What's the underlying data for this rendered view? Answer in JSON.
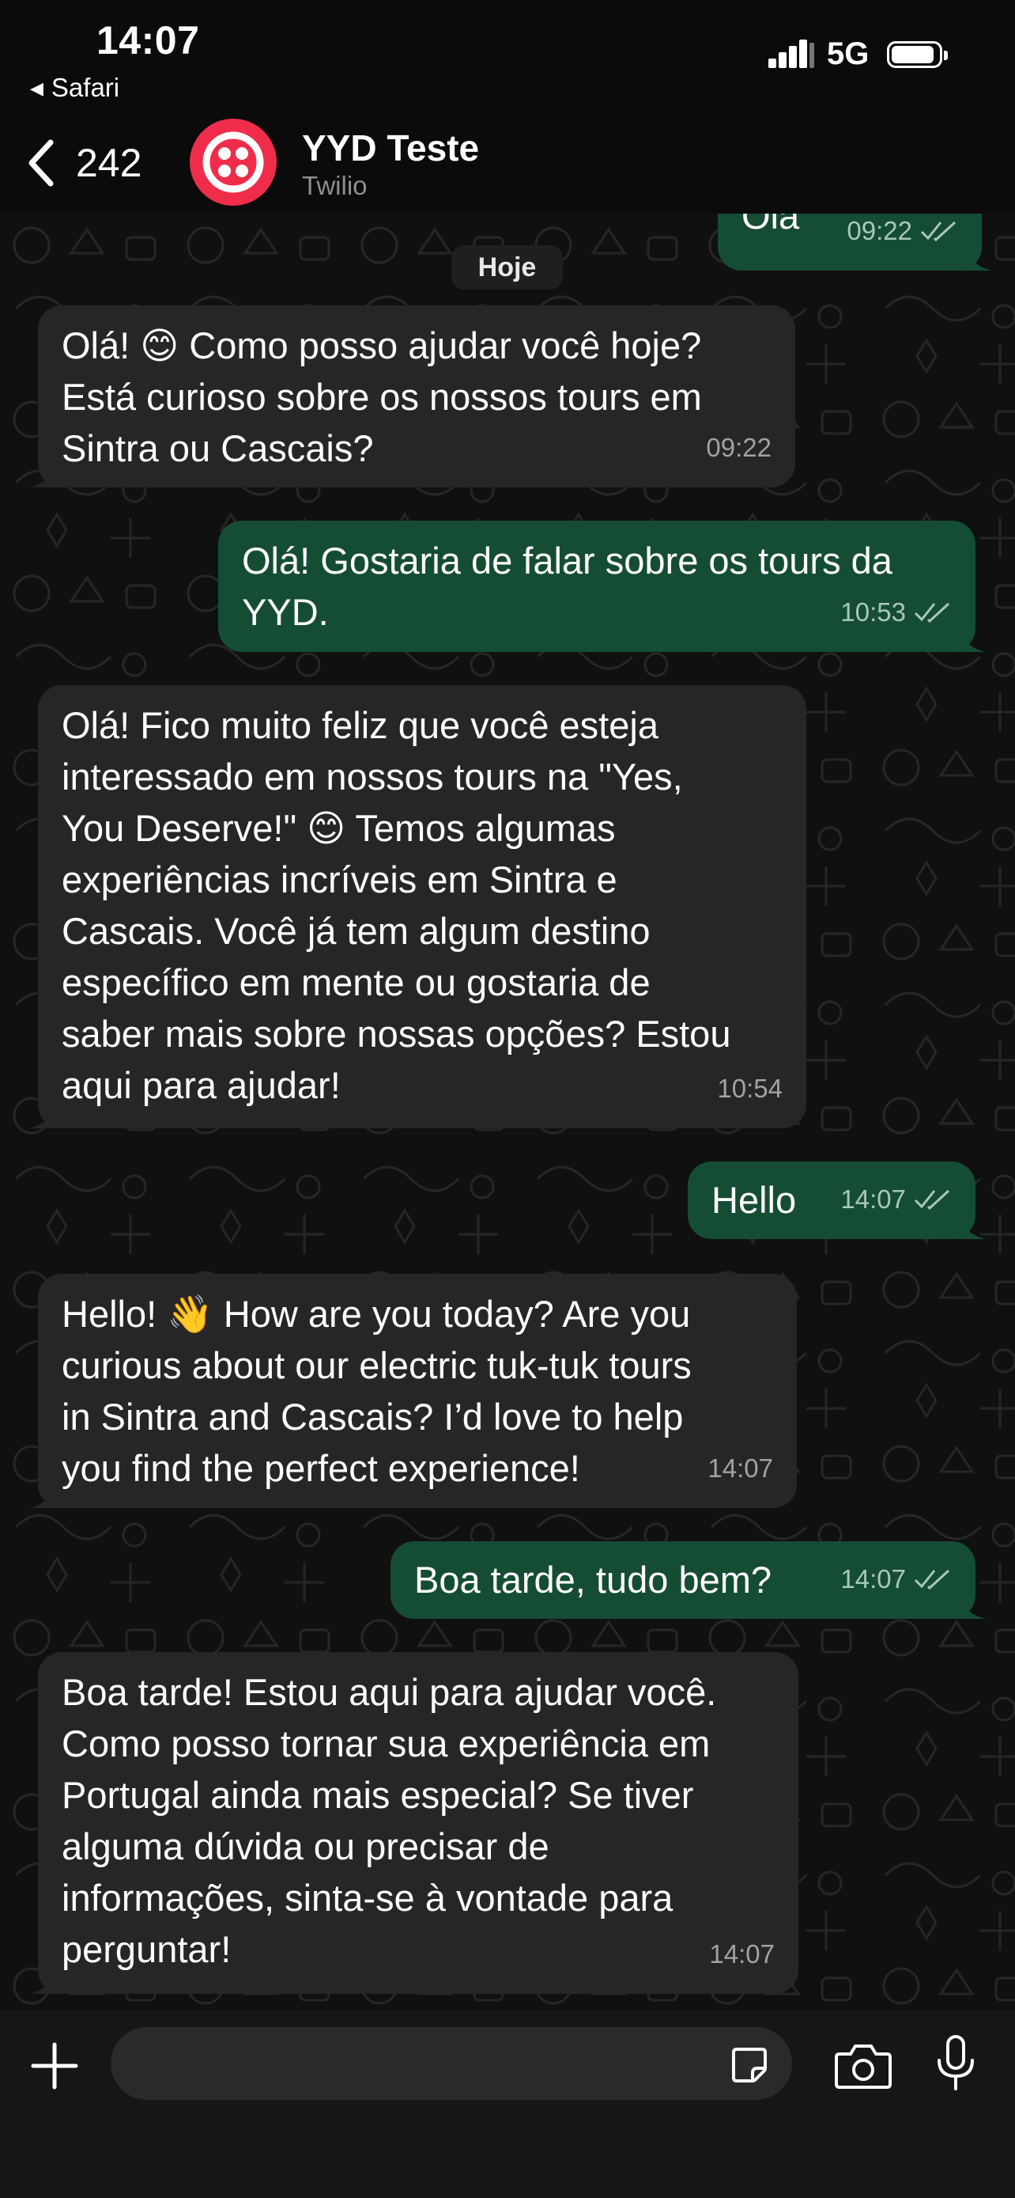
{
  "status_bar": {
    "time": "14:07",
    "back_app": "Safari",
    "network": "5G"
  },
  "header": {
    "unread_count": "242",
    "contact_name": "YYD Teste",
    "contact_subtitle": "Twilio",
    "brand_color": "#ef2d4a"
  },
  "chat": {
    "date_chip": "Hoje",
    "messages": [
      {
        "direction": "outgoing",
        "text": "Ola",
        "time": "09:22",
        "read": true
      },
      {
        "direction": "incoming",
        "text": "Olá! 😊 Como posso ajudar você hoje?\nEstá curioso sobre os nossos tours em\nSintra ou Cascais?",
        "time": "09:22"
      },
      {
        "direction": "outgoing",
        "text": "Olá! Gostaria de falar sobre os tours da\nYYD.",
        "time": "10:53",
        "read": true
      },
      {
        "direction": "incoming",
        "text": "Olá! Fico muito feliz que você esteja\ninteressado em nossos tours na \"Yes,\nYou Deserve!\" 😊 Temos algumas\nexperiências incríveis em Sintra e\nCascais. Você já tem algum destino\nespecífico em mente ou gostaria de\nsaber mais sobre nossas opções? Estou\naqui para ajudar!",
        "time": "10:54"
      },
      {
        "direction": "outgoing",
        "text": "Hello",
        "time": "14:07",
        "read": true
      },
      {
        "direction": "incoming",
        "text": "Hello! 👋 How are you today? Are you\ncurious about our electric tuk-tuk tours\nin Sintra and Cascais? I’d love to help\nyou find the perfect experience!",
        "time": "14:07"
      },
      {
        "direction": "outgoing",
        "text": "Boa tarde, tudo bem?",
        "time": "14:07",
        "read": true
      },
      {
        "direction": "incoming",
        "text": "Boa tarde! Estou aqui para ajudar você.\nComo posso tornar sua experiência em\nPortugal ainda mais especial? Se tiver\nalguma dúvida ou precisar de\ninformações, sinta-se à vontade para\nperguntar!",
        "time": "14:07"
      }
    ]
  },
  "composer": {
    "placeholder": "",
    "icons": [
      "plus-icon",
      "sticker-icon",
      "camera-icon",
      "microphone-icon"
    ]
  },
  "colors": {
    "incoming_bubble": "#262626",
    "outgoing_bubble": "#154d34",
    "background": "#0b0b0b"
  }
}
